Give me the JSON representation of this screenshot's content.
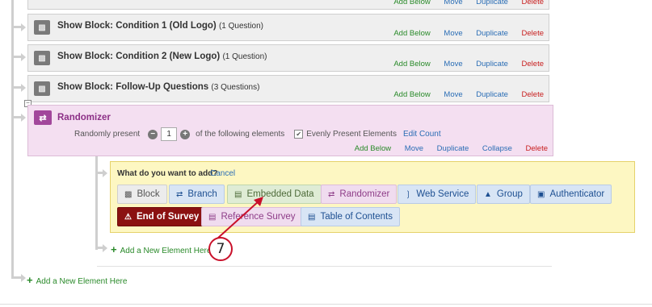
{
  "blocks": [
    {
      "title": "Show Block: Condition 1 (Old Logo)",
      "count": "(1 Question)"
    },
    {
      "title": "Show Block: Condition 2 (New Logo)",
      "count": "(1 Question)"
    },
    {
      "title": "Show Block: Follow-Up Questions",
      "count": "(3 Questions)"
    }
  ],
  "block_actions": {
    "add_below": "Add Below",
    "move": "Move",
    "duplicate": "Duplicate",
    "delete": "Delete"
  },
  "randomizer": {
    "title": "Randomizer",
    "present_prefix": "Randomly present",
    "present_value": "1",
    "present_suffix": "of the following elements",
    "evenly_label": "Evenly Present Elements",
    "edit_count": "Edit Count",
    "actions": {
      "add_below": "Add Below",
      "move": "Move",
      "duplicate": "Duplicate",
      "collapse": "Collapse",
      "delete": "Delete"
    }
  },
  "add_panel": {
    "question": "What do you want to add?",
    "cancel": "Cancel",
    "options_row1": [
      "Block",
      "Branch",
      "Embedded Data",
      "Randomizer",
      "Web Service",
      "Group",
      "Authenticator"
    ],
    "options_row2": [
      "End of Survey",
      "Reference Survey",
      "Table of Contents"
    ]
  },
  "add_new_inner": "Add a New Element Here",
  "add_new_outer": "Add a New Element Here",
  "callout_number": "7",
  "colors": {
    "accent_red": "#c9102a",
    "randomizer_purple": "#a2479b",
    "link_blue": "#2a6db5",
    "link_green": "#2a8a2a"
  }
}
